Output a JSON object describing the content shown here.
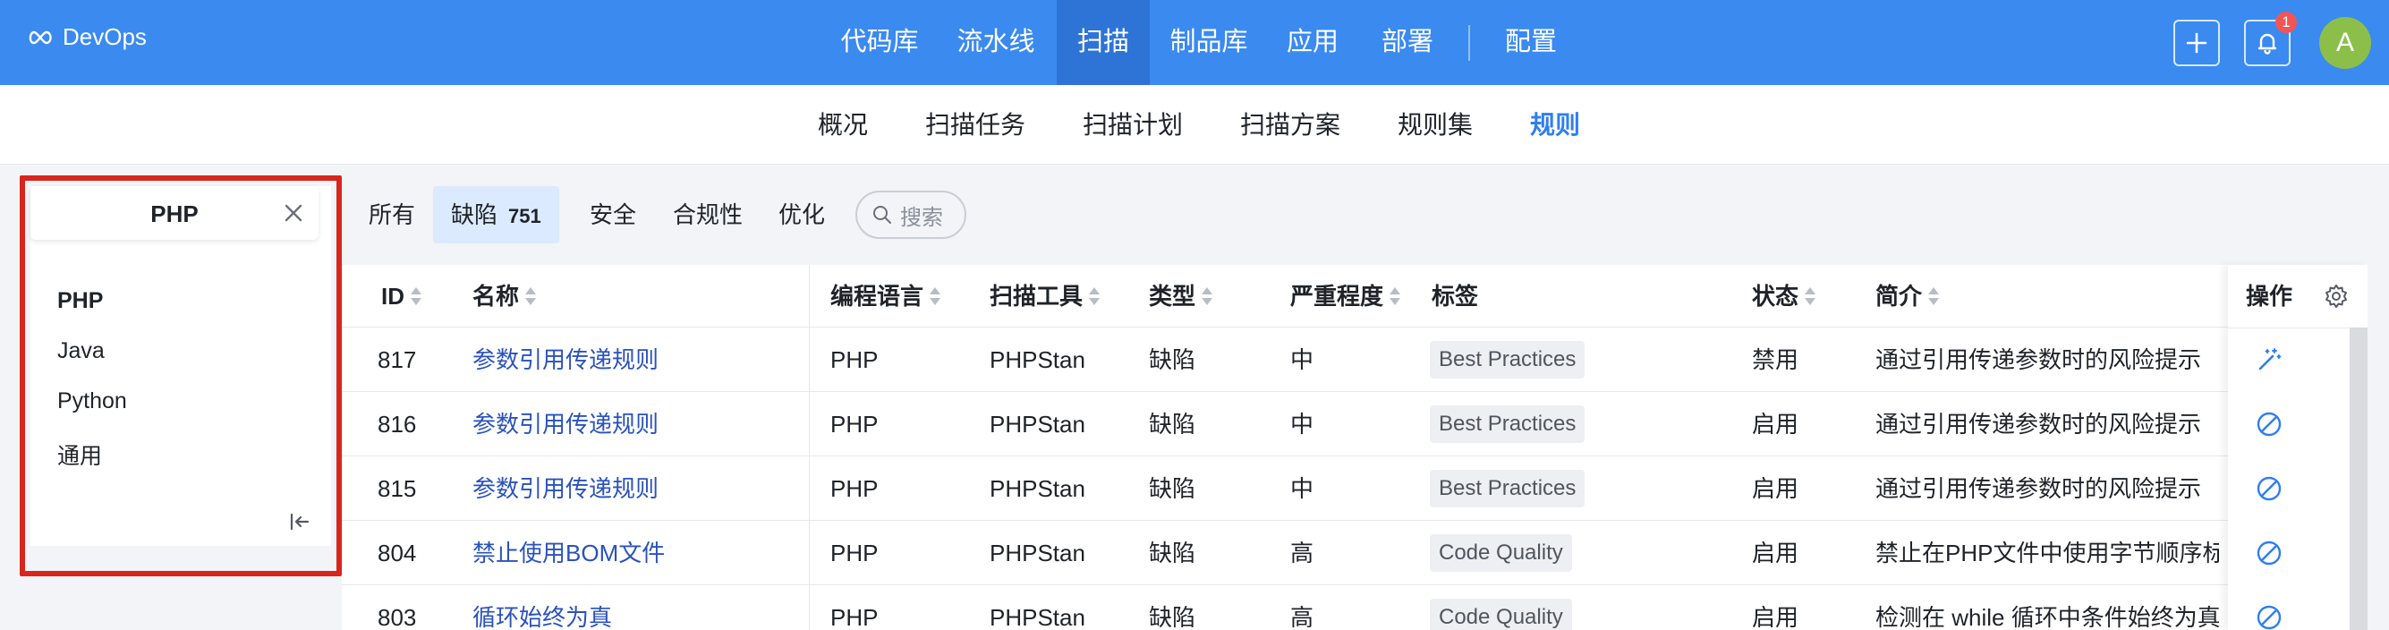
{
  "app": {
    "name": "DevOps"
  },
  "nav": {
    "items": [
      "代码库",
      "流水线",
      "扫描",
      "制品库",
      "应用",
      "部署",
      "配置"
    ],
    "active": "扫描",
    "notification_count": "1",
    "avatar_initial": "A"
  },
  "subnav": {
    "items": [
      "概况",
      "扫描任务",
      "扫描计划",
      "扫描方案",
      "规则集",
      "规则"
    ],
    "active": "规则"
  },
  "left_panel": {
    "selected": "PHP",
    "languages": [
      "PHP",
      "Java",
      "Python",
      "通用"
    ]
  },
  "filters": {
    "all": "所有",
    "defect": "缺陷",
    "defect_count": "751",
    "security": "安全",
    "compliance": "合规性",
    "optimize": "优化",
    "search_placeholder": "搜索"
  },
  "table": {
    "headers": {
      "id": "ID",
      "name": "名称",
      "language": "编程语言",
      "tool": "扫描工具",
      "type": "类型",
      "severity": "严重程度",
      "tags": "标签",
      "status": "状态",
      "desc": "简介",
      "ops": "操作"
    },
    "rows": [
      {
        "id": "817",
        "name": "参数引用传递规则",
        "language": "PHP",
        "tool": "PHPStan",
        "type": "缺陷",
        "severity": "中",
        "tag": "Best Practices",
        "status": "禁用",
        "desc": "通过引用传递参数时的风险提示",
        "op_icon": "magic-wand-icon"
      },
      {
        "id": "816",
        "name": "参数引用传递规则",
        "language": "PHP",
        "tool": "PHPStan",
        "type": "缺陷",
        "severity": "中",
        "tag": "Best Practices",
        "status": "启用",
        "desc": "通过引用传递参数时的风险提示",
        "op_icon": "disable-icon"
      },
      {
        "id": "815",
        "name": "参数引用传递规则",
        "language": "PHP",
        "tool": "PHPStan",
        "type": "缺陷",
        "severity": "中",
        "tag": "Best Practices",
        "status": "启用",
        "desc": "通过引用传递参数时的风险提示",
        "op_icon": "disable-icon"
      },
      {
        "id": "804",
        "name": "禁止使用BOM文件",
        "language": "PHP",
        "tool": "PHPStan",
        "type": "缺陷",
        "severity": "高",
        "tag": "Code Quality",
        "status": "启用",
        "desc": "禁止在PHP文件中使用字节顺序标记",
        "op_icon": "disable-icon"
      },
      {
        "id": "803",
        "name": "循环始终为真",
        "language": "PHP",
        "tool": "PHPStan",
        "type": "缺陷",
        "severity": "高",
        "tag": "Code Quality",
        "status": "启用",
        "desc": "检测在 while 循环中条件始终为真的情况",
        "op_icon": "disable-icon"
      }
    ]
  },
  "colors": {
    "brand": "#3a8af0",
    "active_nav": "#2d74d6",
    "link": "#2a52be",
    "highlight_frame": "#d8251d"
  }
}
